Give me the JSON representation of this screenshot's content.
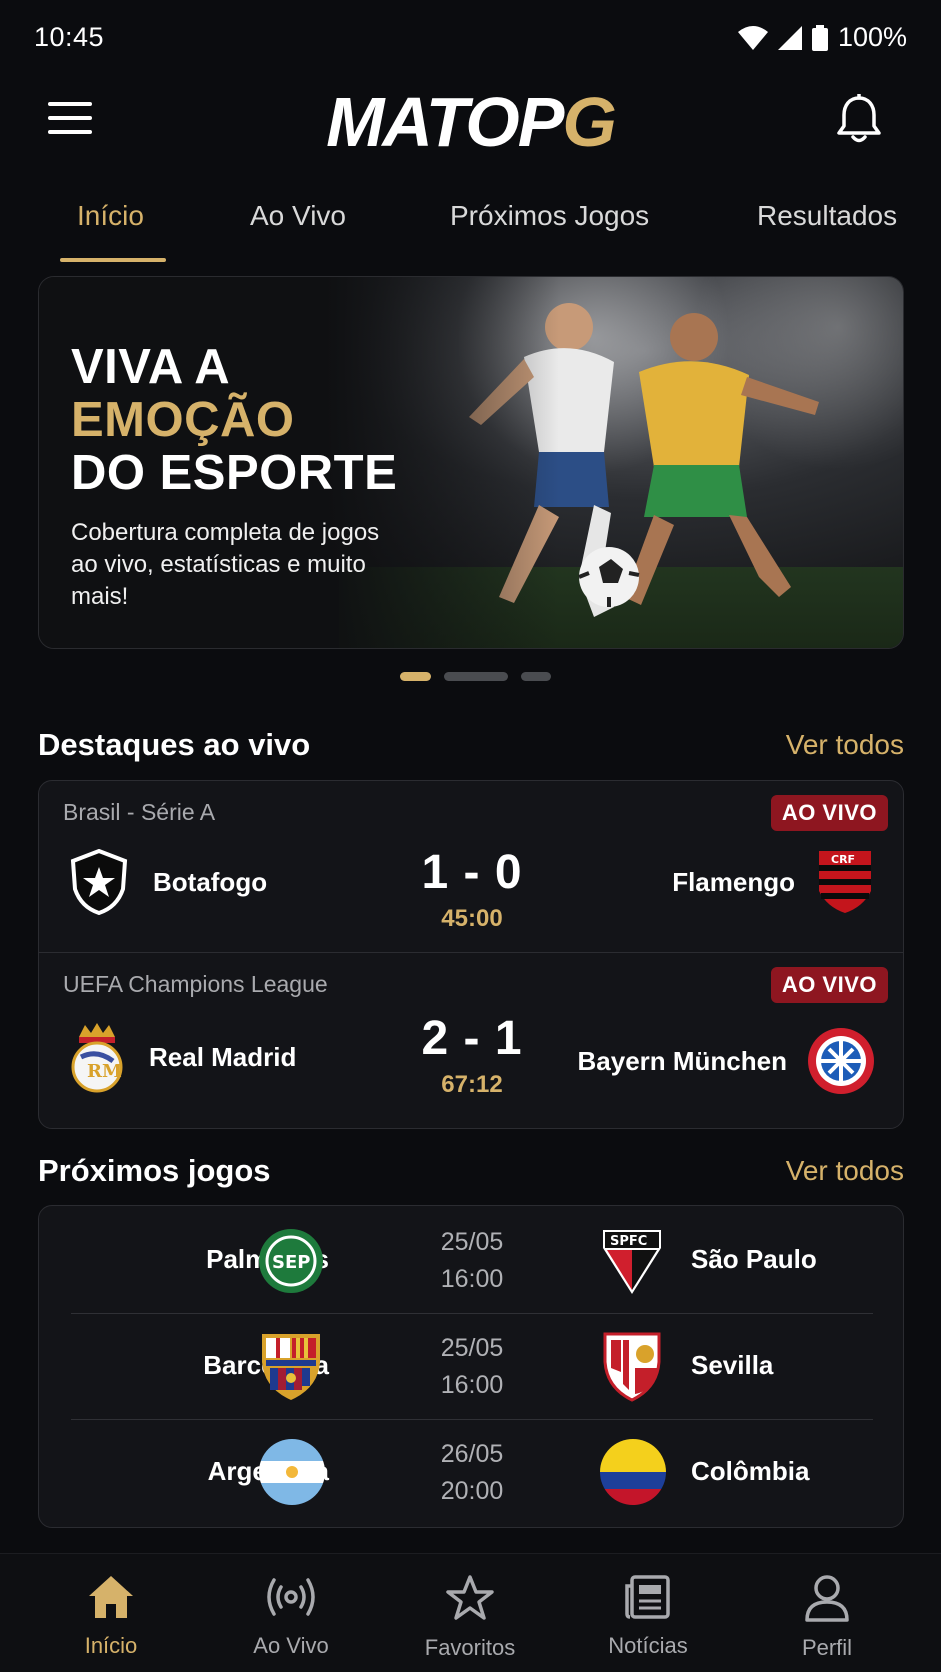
{
  "status_bar": {
    "time": "10:45",
    "battery": "100%"
  },
  "header": {
    "logo_main": "MATOP",
    "logo_accent": "G"
  },
  "tabs": [
    {
      "label": "Início",
      "active": true
    },
    {
      "label": "Ao Vivo"
    },
    {
      "label": "Próximos Jogos"
    },
    {
      "label": "Resultados"
    }
  ],
  "banner": {
    "title_line1": "VIVA A",
    "title_line2": "EMOÇÃO",
    "title_line3": "DO ESPORTE",
    "subtitle": "Cobertura completa de jogos ao vivo, estatísticas e muito mais!",
    "slides": 3,
    "active_slide": 1
  },
  "live_section": {
    "title": "Destaques ao vivo",
    "see_all": "Ver todos",
    "matches": [
      {
        "league": "Brasil - Série A",
        "badge": "AO VIVO",
        "home": "Botafogo",
        "away": "Flamengo",
        "score": "1 - 0",
        "clock": "45:00"
      },
      {
        "league": "UEFA Champions League",
        "badge": "AO VIVO",
        "home": "Real Madrid",
        "away": "Bayern München",
        "score": "2 - 1",
        "clock": "67:12"
      }
    ]
  },
  "upcoming_section": {
    "title": "Próximos jogos",
    "see_all": "Ver todos",
    "fixtures": [
      {
        "home": "Palmeiras",
        "away": "São Paulo",
        "date": "25/05",
        "time": "16:00"
      },
      {
        "home": "Barcelona",
        "away": "Sevilla",
        "date": "25/05",
        "time": "16:00"
      },
      {
        "home": "Argentina",
        "away": "Colômbia",
        "date": "26/05",
        "time": "20:00"
      }
    ]
  },
  "bottom_nav": [
    {
      "label": "Início",
      "icon": "home-icon",
      "active": true
    },
    {
      "label": "Ao Vivo",
      "icon": "broadcast-icon"
    },
    {
      "label": "Favoritos",
      "icon": "star-icon"
    },
    {
      "label": "Notícias",
      "icon": "newspaper-icon"
    },
    {
      "label": "Perfil",
      "icon": "user-icon"
    }
  ],
  "colors": {
    "accent": "#d6b26a",
    "live": "#8e1620",
    "background": "#0b0c0f",
    "card": "#131418"
  }
}
